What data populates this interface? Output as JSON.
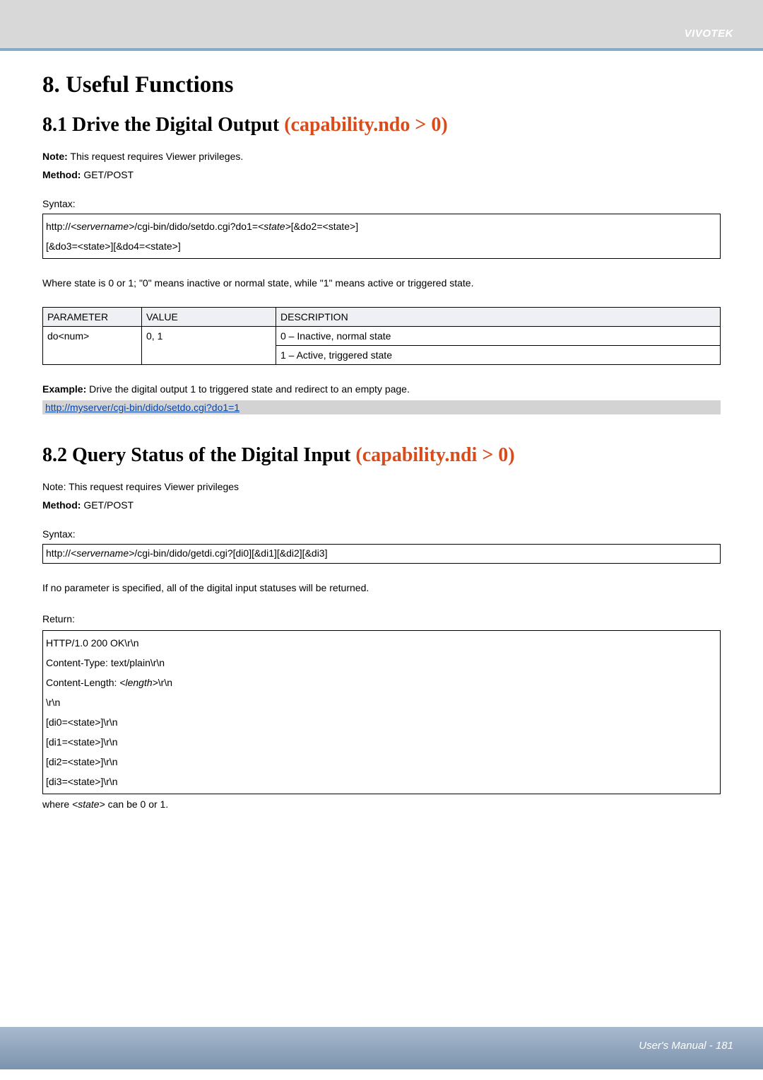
{
  "brand": "VIVOTEK",
  "section": {
    "title": "8. Useful Functions",
    "s81": {
      "heading": "8.1 Drive the Digital Output ",
      "cap": "(capability.ndo > 0)",
      "note_label": "Note:",
      "note_text": " This request requires Viewer privileges.",
      "method_label": "Method:",
      "method_text": " GET/POST",
      "syntax_label": "Syntax:",
      "syntax_box_line1a": "http://",
      "syntax_box_line1b": "<servername>",
      "syntax_box_line1c": "/cgi-bin/dido/setdo.cgi?do1=",
      "syntax_box_line1d": "<state>",
      "syntax_box_line1e": "[&do2=<state>]",
      "syntax_box_line2": "[&do3=<state>][&do4=<state>]",
      "state_desc": "Where state is 0 or 1; \"0\" means inactive or normal state, while \"1\" means active or triggered state.",
      "table": {
        "h1": "PARAMETER",
        "h2": "VALUE",
        "h3": "DESCRIPTION",
        "r1c1": "do<num>",
        "r1c2": "0, 1",
        "r1c3": "0 – Inactive, normal state",
        "r2c3": "1 – Active, triggered state"
      },
      "example_label": "Example:",
      "example_text": " Drive the digital output 1 to triggered state and redirect to an empty page.",
      "example_link": "http://myserver/cgi-bin/dido/setdo.cgi?do1=1"
    },
    "s82": {
      "heading": "8.2 Query Status of the Digital Input ",
      "cap": "(capability.ndi > 0)",
      "note_text": "Note: This request requires Viewer privileges",
      "method_label": "Method:",
      "method_text": " GET/POST",
      "syntax_label": "Syntax:",
      "syntax_box_a": "http://",
      "syntax_box_b": "<servername>",
      "syntax_box_c": "/cgi-bin/dido/getdi.cgi?[di0][&di1][&di2][&di3]",
      "desc": "If no parameter is specified, all of the digital input statuses will be returned.",
      "return_label": "Return:",
      "return_box": {
        "l1": "HTTP/1.0 200 OK\\r\\n",
        "l2": "Content-Type: text/plain\\r\\n",
        "l3a": "Content-Length: ",
        "l3b": "<length>",
        "l3c": "\\r\\n",
        "l4": "\\r\\n",
        "l5": "[di0=<state>]\\r\\n",
        "l6": "[di1=<state>]\\r\\n",
        "l7": "[di2=<state>]\\r\\n",
        "l8": "[di3=<state>]\\r\\n"
      },
      "where_a": "where ",
      "where_b": "<state>",
      "where_c": " can be 0 or 1."
    }
  },
  "footer": "User's Manual - 181"
}
